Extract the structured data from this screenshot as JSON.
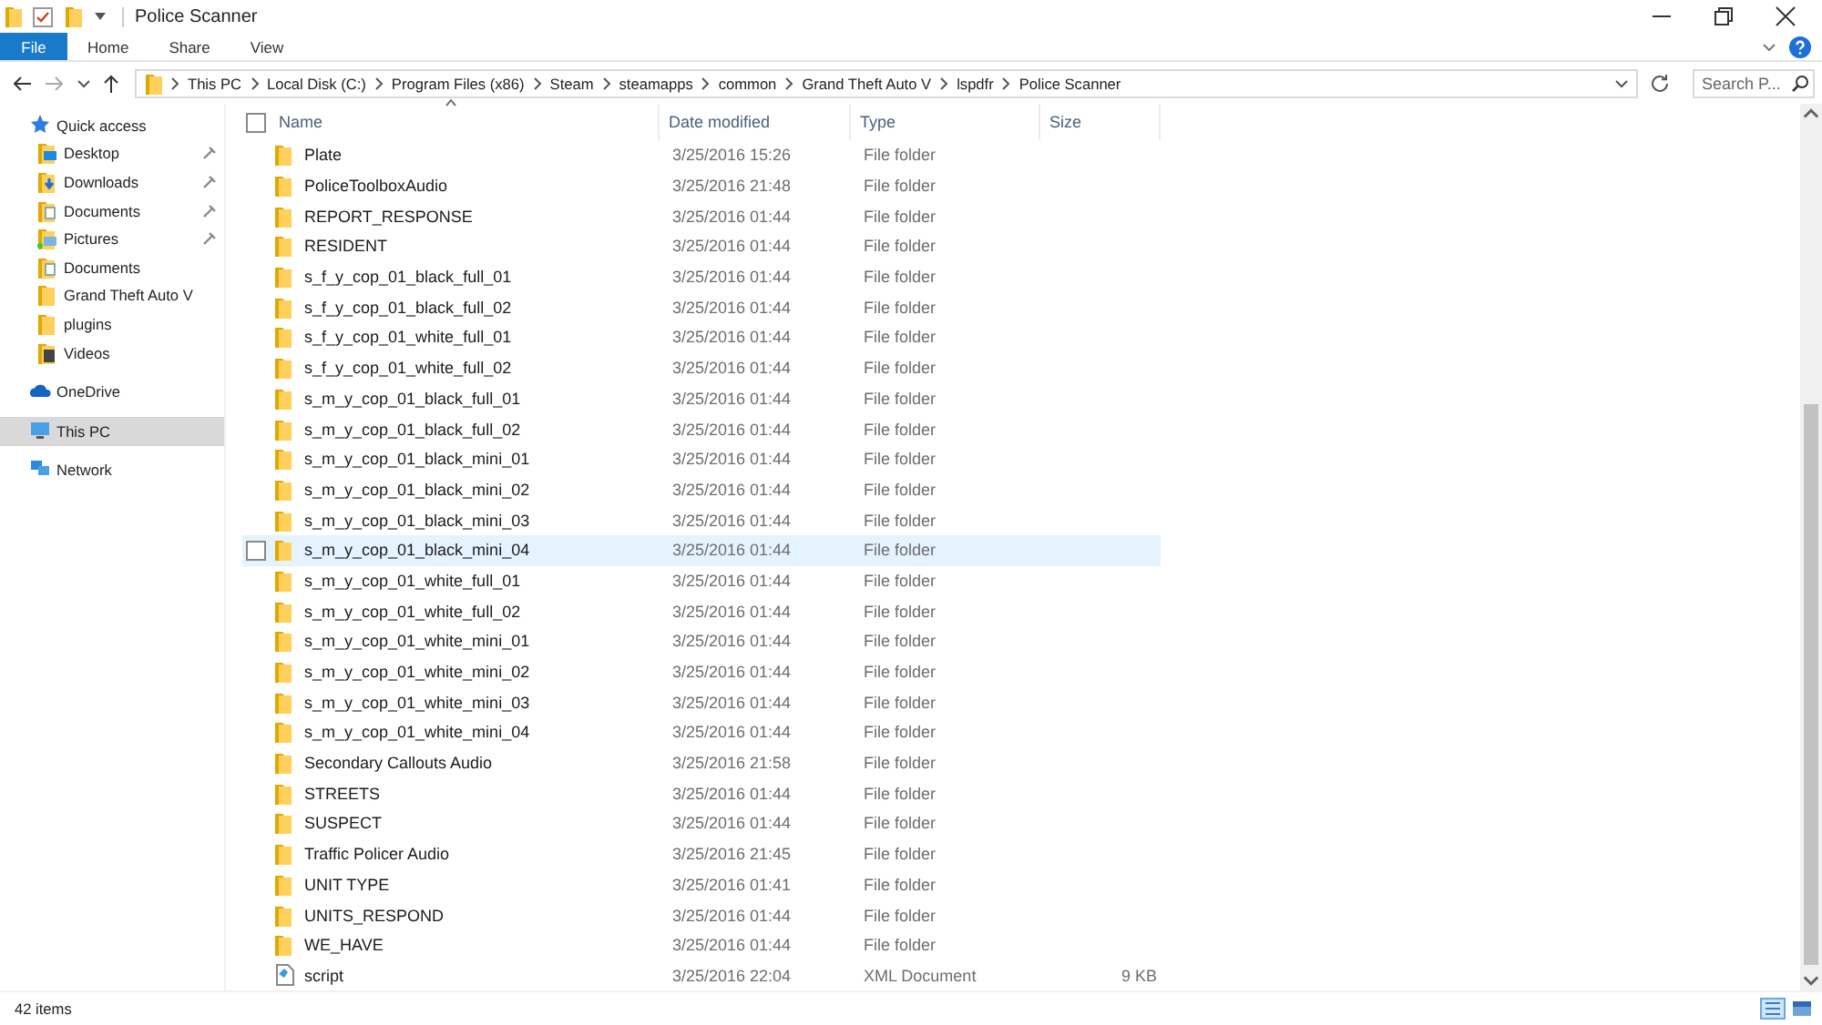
{
  "window": {
    "title": "Police Scanner"
  },
  "ribbon": {
    "tabs": [
      {
        "label": "File",
        "kind": "file"
      },
      {
        "label": "Home",
        "kind": "tab"
      },
      {
        "label": "Share",
        "kind": "tab"
      },
      {
        "label": "View",
        "kind": "tab"
      }
    ]
  },
  "address": {
    "crumbs": [
      "This PC",
      "Local Disk (C:)",
      "Program Files (x86)",
      "Steam",
      "steamapps",
      "common",
      "Grand Theft Auto V",
      "lspdfr",
      "Police Scanner"
    ],
    "search_placeholder": "Search P..."
  },
  "sidebar": {
    "items": [
      {
        "label": "Quick access",
        "kind": "star",
        "selected": false,
        "children": [
          {
            "label": "Desktop",
            "kind": "desktop",
            "pinned": true,
            "selected": false
          },
          {
            "label": "Downloads",
            "kind": "download",
            "pinned": true,
            "selected": false
          },
          {
            "label": "Documents",
            "kind": "document",
            "pinned": true,
            "selected": false
          },
          {
            "label": "Pictures",
            "kind": "pictures",
            "pinned": true,
            "selected": false
          },
          {
            "label": "Documents",
            "kind": "document",
            "pinned": false,
            "selected": false
          },
          {
            "label": "Grand Theft Auto V",
            "kind": "folder",
            "pinned": false,
            "selected": false
          },
          {
            "label": "plugins",
            "kind": "folder",
            "pinned": false,
            "selected": false
          },
          {
            "label": "Videos",
            "kind": "video",
            "pinned": false,
            "selected": false
          }
        ]
      },
      {
        "label": "OneDrive",
        "kind": "cloud",
        "selected": false
      },
      {
        "label": "This PC",
        "kind": "pc",
        "selected": true
      },
      {
        "label": "Network",
        "kind": "network",
        "selected": false
      }
    ]
  },
  "table": {
    "select_all": {
      "checked": false
    },
    "columns": [
      "Name",
      "Date modified",
      "Type",
      "Size"
    ],
    "rows": [
      {
        "name": "Plate",
        "date": "3/25/2016 15:26",
        "type": "File folder",
        "kind": "folder",
        "hovered": false
      },
      {
        "name": "PoliceToolboxAudio",
        "date": "3/25/2016 21:48",
        "type": "File folder",
        "kind": "folder",
        "hovered": false
      },
      {
        "name": "REPORT_RESPONSE",
        "date": "3/25/2016 01:44",
        "type": "File folder",
        "kind": "folder",
        "hovered": false
      },
      {
        "name": "RESIDENT",
        "date": "3/25/2016 01:44",
        "type": "File folder",
        "kind": "folder",
        "hovered": false
      },
      {
        "name": "s_f_y_cop_01_black_full_01",
        "date": "3/25/2016 01:44",
        "type": "File folder",
        "kind": "folder",
        "hovered": false
      },
      {
        "name": "s_f_y_cop_01_black_full_02",
        "date": "3/25/2016 01:44",
        "type": "File folder",
        "kind": "folder",
        "hovered": false
      },
      {
        "name": "s_f_y_cop_01_white_full_01",
        "date": "3/25/2016 01:44",
        "type": "File folder",
        "kind": "folder",
        "hovered": false
      },
      {
        "name": "s_f_y_cop_01_white_full_02",
        "date": "3/25/2016 01:44",
        "type": "File folder",
        "kind": "folder",
        "hovered": false
      },
      {
        "name": "s_m_y_cop_01_black_full_01",
        "date": "3/25/2016 01:44",
        "type": "File folder",
        "kind": "folder",
        "hovered": false
      },
      {
        "name": "s_m_y_cop_01_black_full_02",
        "date": "3/25/2016 01:44",
        "type": "File folder",
        "kind": "folder",
        "hovered": false
      },
      {
        "name": "s_m_y_cop_01_black_mini_01",
        "date": "3/25/2016 01:44",
        "type": "File folder",
        "kind": "folder",
        "hovered": false
      },
      {
        "name": "s_m_y_cop_01_black_mini_02",
        "date": "3/25/2016 01:44",
        "type": "File folder",
        "kind": "folder",
        "hovered": false
      },
      {
        "name": "s_m_y_cop_01_black_mini_03",
        "date": "3/25/2016 01:44",
        "type": "File folder",
        "kind": "folder",
        "hovered": false
      },
      {
        "name": "s_m_y_cop_01_black_mini_04",
        "date": "3/25/2016 01:44",
        "type": "File folder",
        "kind": "folder",
        "hovered": true
      },
      {
        "name": "s_m_y_cop_01_white_full_01",
        "date": "3/25/2016 01:44",
        "type": "File folder",
        "kind": "folder",
        "hovered": false
      },
      {
        "name": "s_m_y_cop_01_white_full_02",
        "date": "3/25/2016 01:44",
        "type": "File folder",
        "kind": "folder",
        "hovered": false
      },
      {
        "name": "s_m_y_cop_01_white_mini_01",
        "date": "3/25/2016 01:44",
        "type": "File folder",
        "kind": "folder",
        "hovered": false
      },
      {
        "name": "s_m_y_cop_01_white_mini_02",
        "date": "3/25/2016 01:44",
        "type": "File folder",
        "kind": "folder",
        "hovered": false
      },
      {
        "name": "s_m_y_cop_01_white_mini_03",
        "date": "3/25/2016 01:44",
        "type": "File folder",
        "kind": "folder",
        "hovered": false
      },
      {
        "name": "s_m_y_cop_01_white_mini_04",
        "date": "3/25/2016 01:44",
        "type": "File folder",
        "kind": "folder",
        "hovered": false
      },
      {
        "name": "Secondary Callouts Audio",
        "date": "3/25/2016 21:58",
        "type": "File folder",
        "kind": "folder",
        "hovered": false
      },
      {
        "name": "STREETS",
        "date": "3/25/2016 01:44",
        "type": "File folder",
        "kind": "folder",
        "hovered": false
      },
      {
        "name": "SUSPECT",
        "date": "3/25/2016 01:44",
        "type": "File folder",
        "kind": "folder",
        "hovered": false
      },
      {
        "name": "Traffic Policer Audio",
        "date": "3/25/2016 21:45",
        "type": "File folder",
        "kind": "folder",
        "hovered": false
      },
      {
        "name": "UNIT TYPE",
        "date": "3/25/2016 01:41",
        "type": "File folder",
        "kind": "folder",
        "hovered": false
      },
      {
        "name": "UNITS_RESPOND",
        "date": "3/25/2016 01:44",
        "type": "File folder",
        "kind": "folder",
        "hovered": false
      },
      {
        "name": "WE_HAVE",
        "date": "3/25/2016 01:44",
        "type": "File folder",
        "kind": "folder",
        "hovered": false
      },
      {
        "name": "script",
        "date": "3/25/2016 22:04",
        "type": "XML Document",
        "size": "9 KB",
        "kind": "file",
        "hovered": false
      }
    ]
  },
  "status_bar": {
    "count": "42 items"
  }
}
